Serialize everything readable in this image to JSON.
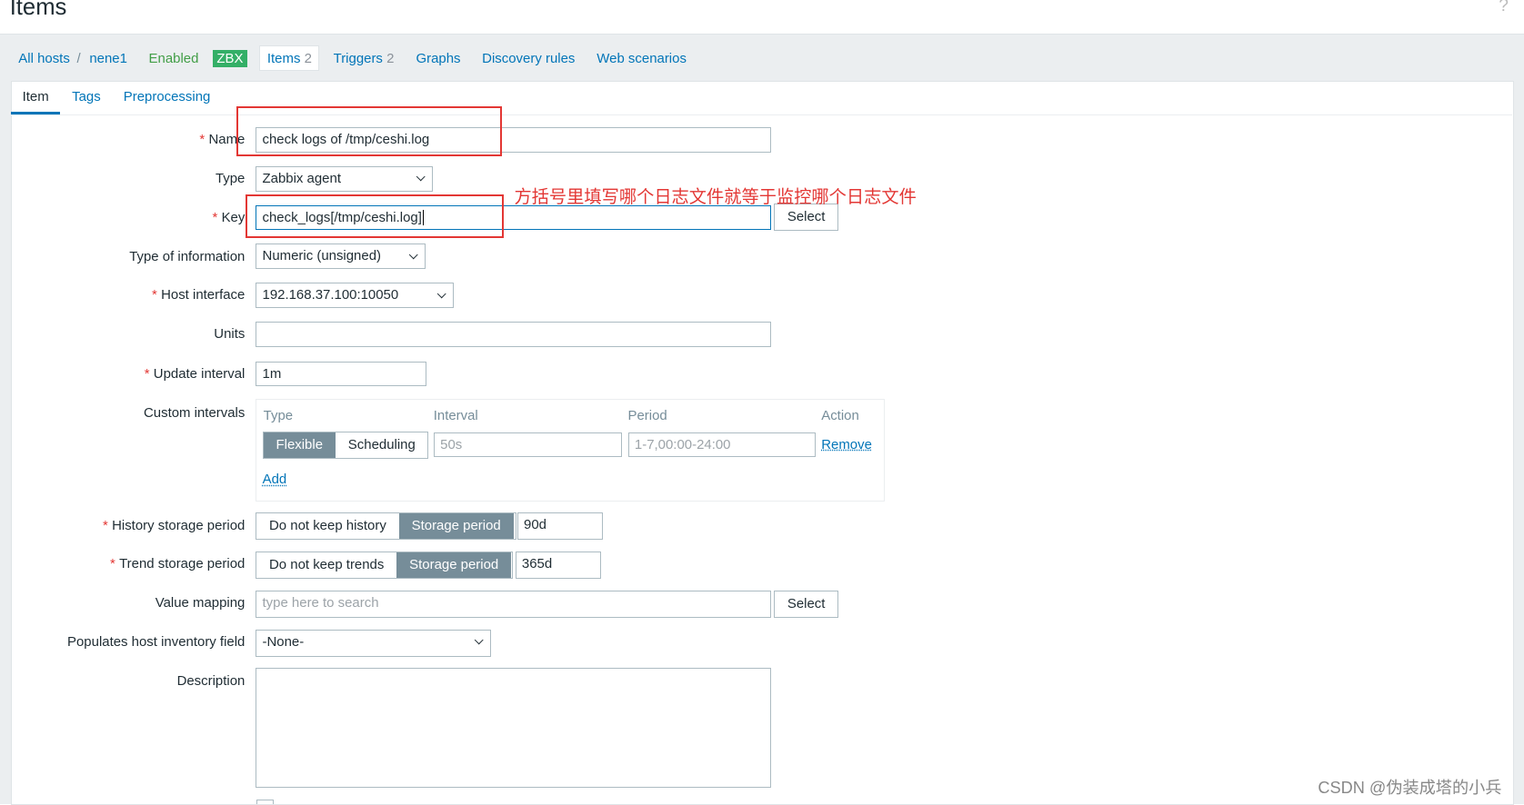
{
  "page": {
    "title": "Items",
    "help": "?"
  },
  "nav": {
    "all_hosts": "All hosts",
    "sep": "/",
    "host": "nene1",
    "status": "Enabled",
    "zbx": "ZBX",
    "items": "Items",
    "items_count": "2",
    "triggers": "Triggers",
    "triggers_count": "2",
    "graphs": "Graphs",
    "discovery": "Discovery rules",
    "web": "Web scenarios"
  },
  "tabs": [
    "Item",
    "Tags",
    "Preprocessing"
  ],
  "form": {
    "name": {
      "label": "Name",
      "value": "check logs of /tmp/ceshi.log"
    },
    "type": {
      "label": "Type",
      "value": "Zabbix agent"
    },
    "key": {
      "label": "Key",
      "value": "check_logs[/tmp/ceshi.log]",
      "select": "Select"
    },
    "type_info": {
      "label": "Type of information",
      "value": "Numeric (unsigned)"
    },
    "host_interface": {
      "label": "Host interface",
      "value": "192.168.37.100:10050"
    },
    "units": {
      "label": "Units",
      "value": ""
    },
    "update_interval": {
      "label": "Update interval",
      "value": "1m"
    },
    "custom": {
      "label": "Custom intervals",
      "headers": [
        "Type",
        "Interval",
        "Period",
        "Action"
      ],
      "flexible": "Flexible",
      "scheduling": "Scheduling",
      "interval_placeholder": "50s",
      "period_placeholder": "1-7,00:00-24:00",
      "remove": "Remove",
      "add": "Add"
    },
    "history": {
      "label": "History storage period",
      "opt1": "Do not keep history",
      "opt2": "Storage period",
      "value": "90d"
    },
    "trend": {
      "label": "Trend storage period",
      "opt1": "Do not keep trends",
      "opt2": "Storage period",
      "value": "365d"
    },
    "value_mapping": {
      "label": "Value mapping",
      "placeholder": "type here to search",
      "select": "Select"
    },
    "inventory": {
      "label": "Populates host inventory field",
      "value": "-None-"
    },
    "description": {
      "label": "Description",
      "value": ""
    }
  },
  "annotation": "方括号里填写哪个日志文件就等于监控哪个日志文件",
  "watermark": "CSDN @伪装成塔的小兵",
  "colors": {
    "accent": "#0275b8",
    "annotation": "#e33734",
    "enabled": "#34af67"
  }
}
